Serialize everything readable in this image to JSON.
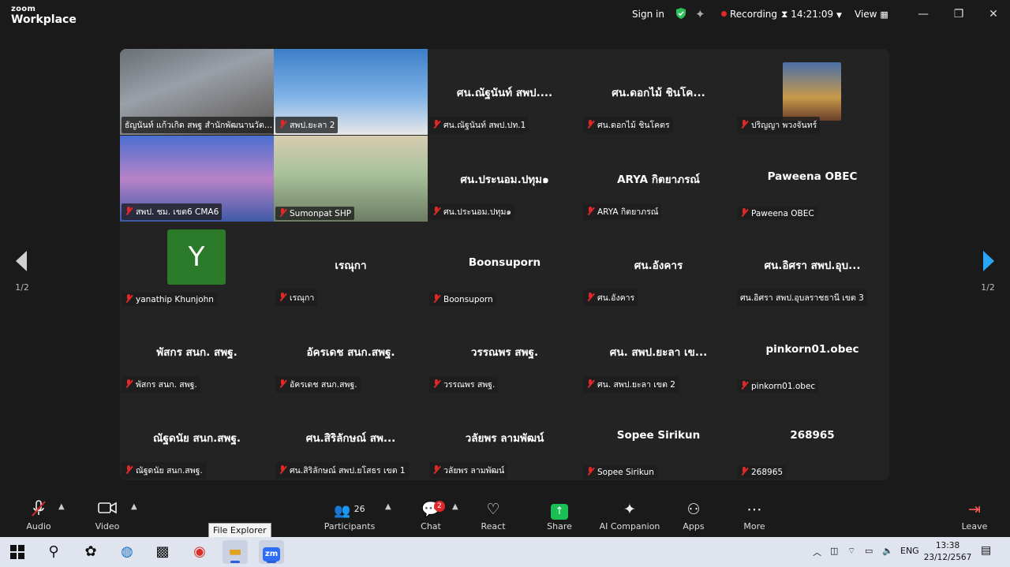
{
  "app": {
    "brand_top": "zoom",
    "brand_bottom": "Workplace"
  },
  "titlebar": {
    "signin": "Sign in",
    "recording": "Recording",
    "timer": "14:21:09",
    "view": "View"
  },
  "tiles": [
    {
      "big": "",
      "label": "ธัญนันท์ แก้วเกิด สพฐ สำนักพัฒนานวัตกรรม",
      "mic_muted": false,
      "video": true,
      "active": true
    },
    {
      "big": "",
      "label": "สพป.ยะลา 2",
      "mic_muted": true,
      "video": true
    },
    {
      "big": "ศน.ณัฐนันท์ สพป....",
      "label": "ศน.ณัฐนันท์ สพป.ปท.1",
      "mic_muted": true
    },
    {
      "big": "ศน.ดอกไม้ ชินโค...",
      "label": "ศน.ดอกไม้ ชินโคตร",
      "mic_muted": true
    },
    {
      "big": "",
      "label": "ปริญญา พวงจันทร์",
      "mic_muted": true,
      "photo": true
    },
    {
      "big": "",
      "label": "สพป. ชม. เขต6 CMA6",
      "mic_muted": true,
      "video": true
    },
    {
      "big": "",
      "label": "Sumonpat SHP",
      "mic_muted": true,
      "video": true
    },
    {
      "big": "ศน.ประนอม.ปทุม๑",
      "label": "ศน.ประนอม.ปทุม๑",
      "mic_muted": true
    },
    {
      "big": "ARYA กิตยาภรณ์",
      "label": "ARYA กิตยาภรณ์",
      "mic_muted": true
    },
    {
      "big": "Paweena OBEC",
      "label": "Paweena OBEC",
      "mic_muted": true
    },
    {
      "big": "",
      "label": "yanathip Khunjohn",
      "mic_muted": true,
      "avatar": "Y"
    },
    {
      "big": "เรณุกา",
      "label": "เรณุกา",
      "mic_muted": true
    },
    {
      "big": "Boonsuporn",
      "label": "Boonsuporn",
      "mic_muted": true
    },
    {
      "big": "ศน.อังคาร",
      "label": "ศน.อังคาร",
      "mic_muted": true
    },
    {
      "big": "ศน.อิศรา สพป.อุบ...",
      "label": "ศน.อิศรา สพป.อุบลราชธานี เขต 3",
      "mic_muted": false
    },
    {
      "big": "พัสกร สนก. สพฐ.",
      "label": "พัสกร สนก. สพฐ.",
      "mic_muted": true
    },
    {
      "big": "อัครเดช สนก.สพฐ.",
      "label": "อัครเดช สนก.สพฐ.",
      "mic_muted": true
    },
    {
      "big": "วรรณพร สพฐ.",
      "label": "วรรณพร สพฐ.",
      "mic_muted": true
    },
    {
      "big": "ศน. สพป.ยะลา เข...",
      "label": "ศน. สพป.ยะลา เขต 2",
      "mic_muted": true
    },
    {
      "big": "pinkorn01.obec",
      "label": "pinkorn01.obec",
      "mic_muted": true
    },
    {
      "big": "ณัฐดนัย สนก.สพฐ.",
      "label": "ณัฐดนัย สนก.สพฐ.",
      "mic_muted": true
    },
    {
      "big": "ศน.สิริลักษณ์ สพ...",
      "label": "ศน.สิริลักษณ์ สพป.ยโสธร เขต 1",
      "mic_muted": true
    },
    {
      "big": "วลัยพร ลามพัฒน์",
      "label": "วลัยพร ลามพัฒน์",
      "mic_muted": true
    },
    {
      "big": "Sopee Sirikun",
      "label": "Sopee Sirikun",
      "mic_muted": true
    },
    {
      "big": "268965",
      "label": "268965",
      "mic_muted": true
    }
  ],
  "pager": {
    "left": "1/2",
    "right": "1/2"
  },
  "toolbar": {
    "audio": "Audio",
    "video": "Video",
    "participants": "Participants",
    "participants_count": "26",
    "chat": "Chat",
    "chat_badge": "2",
    "react": "React",
    "share": "Share",
    "ai": "AI Companion",
    "apps": "Apps",
    "more": "More",
    "leave": "Leave"
  },
  "tooltip": "File Explorer",
  "taskbar": {
    "lang": "ENG",
    "time": "13:38",
    "date": "23/12/2567"
  },
  "colors": {
    "accent_green": "#3fd36b",
    "muted_red": "#e02828",
    "nav_blue": "#2aa6f5"
  }
}
